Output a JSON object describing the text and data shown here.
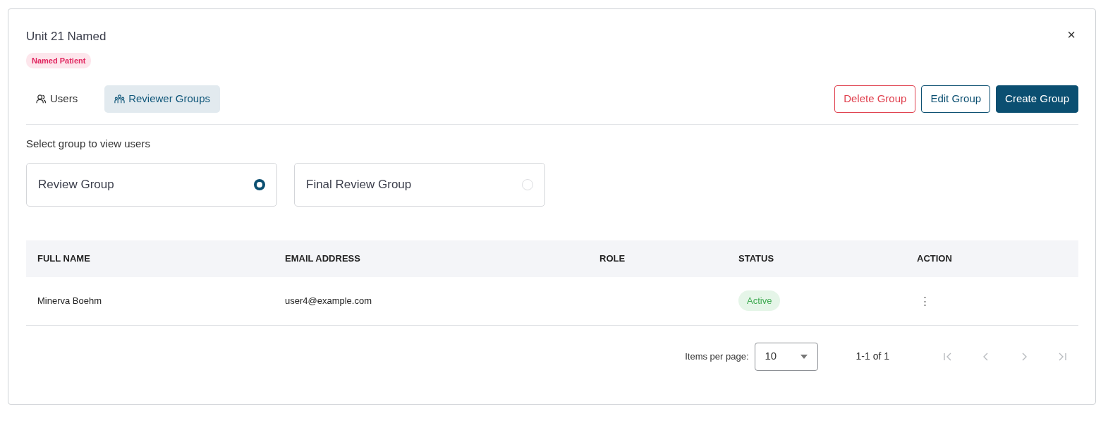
{
  "dialog": {
    "title": "Unit 21 Named",
    "tag": "Named Patient",
    "close": "×"
  },
  "tabs": [
    {
      "label": "Users",
      "selected": false
    },
    {
      "label": "Reviewer Groups",
      "selected": true
    }
  ],
  "actions": [
    {
      "label": "Delete Group",
      "kind": "danger"
    },
    {
      "label": "Edit Group",
      "kind": "outline"
    },
    {
      "label": "Create Group",
      "kind": "primary"
    }
  ],
  "group_prompt": "Select group to view users",
  "groups": [
    {
      "label": "Review Group",
      "selected": true
    },
    {
      "label": "Final Review Group",
      "selected": false
    }
  ],
  "table": {
    "columns": [
      "FULL NAME",
      "EMAIL ADDRESS",
      "ROLE",
      "STATUS",
      "ACTION"
    ],
    "rows": [
      {
        "full_name": "Minerva Boehm",
        "email": "user4@example.com",
        "status": "Active",
        "action": "⋮"
      }
    ]
  },
  "pagination": {
    "items_label": "Items per page:",
    "page_size": "10",
    "range": "1-1 of 1",
    "buttons": [
      {
        "kind": "first",
        "disabled": true
      },
      {
        "kind": "prev",
        "disabled": true
      },
      {
        "kind": "next",
        "disabled": true
      },
      {
        "kind": "last",
        "disabled": true
      }
    ]
  }
}
